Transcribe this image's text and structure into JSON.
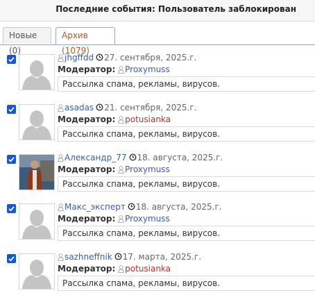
{
  "header": {
    "title": "Последние события: Пользователь заблокирован"
  },
  "tabs": [
    {
      "label": "Новые (0)",
      "active": false
    },
    {
      "label": "Архив (1079)",
      "active": true
    }
  ],
  "moderator_label": "Модератор:",
  "entries": [
    {
      "username": "jhgffdd",
      "date": "27. сентября, 2025.г.",
      "moderator": "Proxymuss",
      "moderator_color": "#3b5ea8",
      "reason": "Рассылка спама, рекламы, вирусов.",
      "checked": true,
      "avatar": "default"
    },
    {
      "username": "asadas",
      "date": "21. сентября, 2025.г.",
      "moderator": "potusianka",
      "moderator_color": "#b5332a",
      "reason": "Рассылка спама, рекламы, вирусов.",
      "checked": true,
      "avatar": "default"
    },
    {
      "username": "Александр_77",
      "date": "18. августа, 2025.г.",
      "moderator": "Proxymuss",
      "moderator_color": "#3b5ea8",
      "reason": "Рассылка спама, рекламы, вирусов.",
      "checked": true,
      "avatar": "photo"
    },
    {
      "username": "Макс_эксперт",
      "date": "18. августа, 2025.г.",
      "moderator": "Proxymuss",
      "moderator_color": "#3b5ea8",
      "reason": "Рассылка спама, рекламы, вирусов.",
      "checked": true,
      "avatar": "default"
    },
    {
      "username": "sazhneffnik",
      "date": "17. марта, 2025.г.",
      "moderator": "potusianka",
      "moderator_color": "#b5332a",
      "reason": "Рассылка спама, рекламы, вирусов.",
      "checked": true,
      "avatar": "default"
    }
  ],
  "colors": {
    "accent": "#3b5ea8",
    "checkbox": "#1a57c9",
    "tab_active_text": "#b05a24"
  }
}
